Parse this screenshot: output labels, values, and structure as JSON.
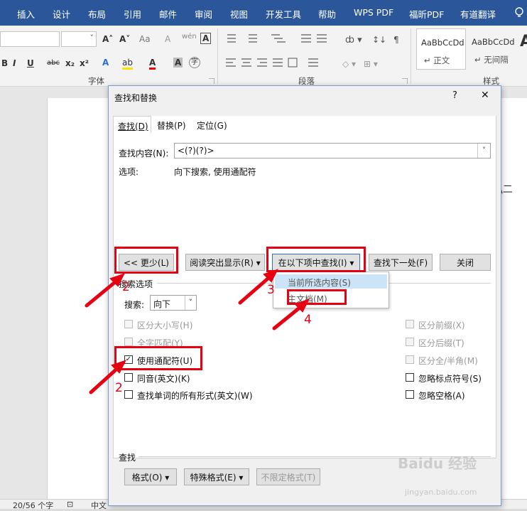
{
  "menubar": {
    "tabs": [
      "插入",
      "设计",
      "布局",
      "引用",
      "邮件",
      "审阅",
      "视图",
      "开发工具",
      "帮助",
      "WPS PDF",
      "福昕PDF",
      "有道翻译"
    ]
  },
  "ribbon": {
    "font_group_label": "字体",
    "paragraph_group_label": "段落",
    "styles_group_label": "样式",
    "style1_preview": "AaBbCcDd",
    "style1_name": "↵ 正文",
    "style2_preview": "AaBbCcDd",
    "style2_name": "↵ 无间隔",
    "style3_preview": "A",
    "font_size_increase": "A˄",
    "font_size_decrease": "A˅",
    "change_case": "Aa",
    "clear_format": "A",
    "phonetic": "wén",
    "char_border": "A",
    "bold": "B",
    "italic": "I",
    "underline": "U",
    "strikethrough": "abc",
    "subscript": "x₂",
    "superscript": "x²",
    "text_effect": "A",
    "highlight": "ab",
    "font_color": "A",
    "char_shading": "A",
    "enclosed_char": "字"
  },
  "statusbar": {
    "word_count": "20/56 个字",
    "lang": "中文"
  },
  "page": {
    "text_fragment": "\\二"
  },
  "dialog": {
    "title": "查找和替换",
    "help": "?",
    "close": "✕",
    "tabs": [
      {
        "label": "查找(D)"
      },
      {
        "label": "替换(P)"
      },
      {
        "label": "定位(G)"
      }
    ],
    "find_label": "查找内容(N):",
    "find_value": "<(?)(?)>",
    "options_label": "选项:",
    "options_value": "向下搜索, 使用通配符",
    "btn_less": "<< 更少(L)",
    "btn_reading_highlight": "阅读突出显示(R) ▾",
    "btn_find_in": "在以下项中查找(I) ▾",
    "btn_find_next": "查找下一处(F)",
    "btn_close": "关闭",
    "dropdown": {
      "item1": "当前所选内容(S)",
      "item2": "主文档(M)"
    },
    "search_options_title": "搜索选项",
    "search_label": "搜索:",
    "search_value": "向下",
    "checkboxes_left": [
      {
        "label": "区分大小写(H)",
        "checked": false,
        "disabled": true
      },
      {
        "label": "全字匹配(Y)",
        "checked": false,
        "disabled": true
      },
      {
        "label": "使用通配符(U)",
        "checked": true,
        "disabled": false
      },
      {
        "label": "同音(英文)(K)",
        "checked": false,
        "disabled": false
      },
      {
        "label": "查找单词的所有形式(英文)(W)",
        "checked": false,
        "disabled": false
      }
    ],
    "checkboxes_right": [
      {
        "label": "区分前缀(X)",
        "checked": false,
        "disabled": true
      },
      {
        "label": "区分后缀(T)",
        "checked": false,
        "disabled": true
      },
      {
        "label": "区分全/半角(M)",
        "checked": false,
        "disabled": true
      },
      {
        "label": "忽略标点符号(S)",
        "checked": false,
        "disabled": false
      },
      {
        "label": "忽略空格(A)",
        "checked": false,
        "disabled": false
      }
    ],
    "find_section_title": "查找",
    "btn_format": "格式(O) ▾",
    "btn_special": "特殊格式(E) ▾",
    "btn_no_format": "不限定格式(T)"
  },
  "annotations": {
    "n1": "2",
    "n2": "3",
    "n3": "4",
    "n4": "2"
  },
  "watermark": {
    "brand": "Baidu 经验",
    "url": "jingyan.baidu.com"
  },
  "colors": {
    "titlebar": "#2b579a",
    "annotation": "#e60012"
  }
}
